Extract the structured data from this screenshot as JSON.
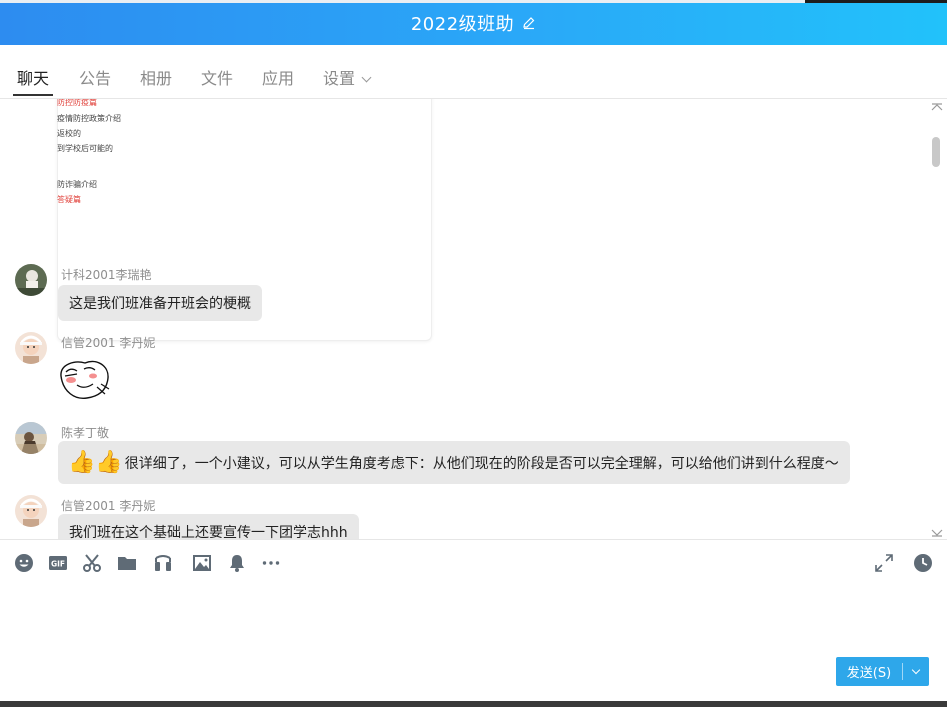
{
  "window": {
    "title": "2022级班助",
    "title_edit_icon": "pencil-icon"
  },
  "tabs": [
    {
      "label": "聊天",
      "active": true
    },
    {
      "label": "公告",
      "active": false
    },
    {
      "label": "相册",
      "active": false
    },
    {
      "label": "文件",
      "active": false
    },
    {
      "label": "应用",
      "active": false
    },
    {
      "label": "设置",
      "active": false,
      "has_dropdown": true
    }
  ],
  "document_preview": {
    "lines": [
      {
        "text": "防控防疫篇",
        "color": "#e0403a"
      },
      {
        "text": "疫情防控政策介绍",
        "color": "#444444"
      },
      {
        "text": "返校的",
        "color": "#444444"
      },
      {
        "text": "到学校后可能的",
        "color": "#444444"
      },
      {
        "text": "防诈骗介绍",
        "color": "#444444"
      },
      {
        "text": "答疑篇",
        "color": "#e0403a"
      }
    ]
  },
  "messages": [
    {
      "sender": "计科2001李瑞艳",
      "text": "这是我们班准备开班会的梗概"
    },
    {
      "sender": "信管2001 李丹妮",
      "sticker": "meme-sticker"
    },
    {
      "sender": "陈孝丁敬",
      "emoji": "👍👍",
      "text": "很详细了，一个小建议，可以从学生角度考虑下：从他们现在的阶段是否可以完全理解，可以给他们讲到什么程度～"
    },
    {
      "sender": "信管2001 李丹妮",
      "text": "我们班在这个基础上还要宣传一下团学志hhh"
    }
  ],
  "toolbar": {
    "icons": [
      "emoji-icon",
      "gif-icon",
      "scissors-icon",
      "folder-icon",
      "music-icon",
      "image-icon",
      "bell-icon",
      "more-icon"
    ],
    "right_icons": [
      "expand-icon",
      "clock-icon"
    ]
  },
  "send_button": {
    "label": "发送(S)"
  },
  "colors": {
    "titlebar_start": "#2d8cf0",
    "titlebar_end": "#22c2fa",
    "send_button": "#2ea7ea",
    "phone": "#2bc36b"
  }
}
